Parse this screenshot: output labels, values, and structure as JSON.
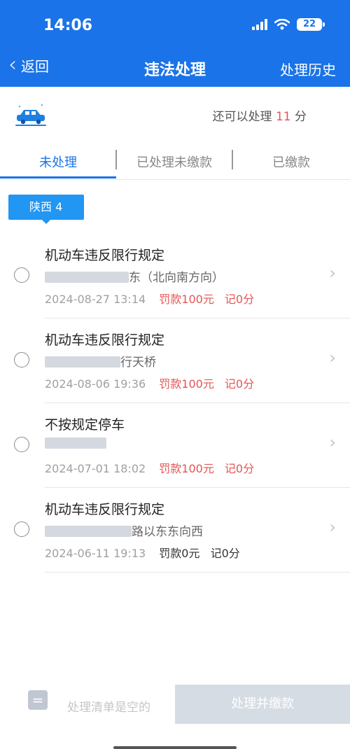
{
  "status_bar": {
    "time": "14:06",
    "battery": "22"
  },
  "nav": {
    "back_label": "返回",
    "title": "违法处理",
    "history_label": "处理历史"
  },
  "summary": {
    "prefix": "还可以处理",
    "count": "11",
    "suffix": "分"
  },
  "tabs": [
    {
      "label": "未处理",
      "active": true
    },
    {
      "label": "已处理未缴款",
      "active": false
    },
    {
      "label": "已缴款",
      "active": false
    }
  ],
  "region": {
    "label": "陕西 4"
  },
  "violations": [
    {
      "title": "机动车违反限行规定",
      "location_visible": "东（北向南方向）",
      "date": "2024-08-27 13:14",
      "fine": "罚款100元",
      "points": "记0分"
    },
    {
      "title": "机动车违反限行规定",
      "location_visible": "行天桥",
      "date": "2024-08-06 19:36",
      "fine": "罚款100元",
      "points": "记0分"
    },
    {
      "title": "不按规定停车",
      "location_visible": "",
      "date": "2024-07-01 18:02",
      "fine": "罚款100元",
      "points": "记0分"
    },
    {
      "title": "机动车违反限行规定",
      "location_visible": "路以东东向西",
      "date": "2024-06-11 19:13",
      "fine": "罚款0元",
      "points": "记0分"
    }
  ],
  "bottom": {
    "empty_label": "处理清单是空的",
    "pay_button": "处理并缴款"
  },
  "colors": {
    "primary": "#1a73e8",
    "tag": "#2196f3",
    "alert": "#e55454"
  }
}
